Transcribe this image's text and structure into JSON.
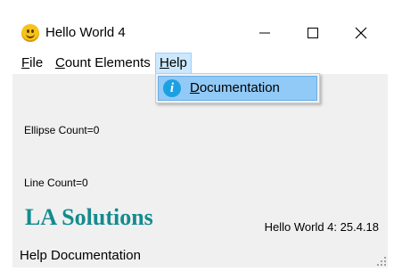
{
  "window": {
    "title": "Hello World 4",
    "icon": "smiley-face-icon"
  },
  "menubar": {
    "file": {
      "pre": "",
      "mnemonic": "F",
      "post": "ile"
    },
    "count_elements": {
      "pre": "",
      "mnemonic": "C",
      "post": "ount Elements"
    },
    "help": {
      "pre": "",
      "mnemonic": "H",
      "post": "elp"
    }
  },
  "help_menu": {
    "items": [
      {
        "icon": "info-icon",
        "glyph": "i",
        "pre": "",
        "mnemonic": "D",
        "post": "ocumentation",
        "highlighted": true
      }
    ]
  },
  "client": {
    "ellipse_count": "Ellipse Count=0",
    "line_count": "Line Count=0",
    "brand": "LA Solutions",
    "version": "Hello World 4: 25.4.18",
    "brand_color": "#138b8e",
    "background": "#f0f0f0"
  },
  "statusbar": {
    "text": "Help Documentation"
  }
}
